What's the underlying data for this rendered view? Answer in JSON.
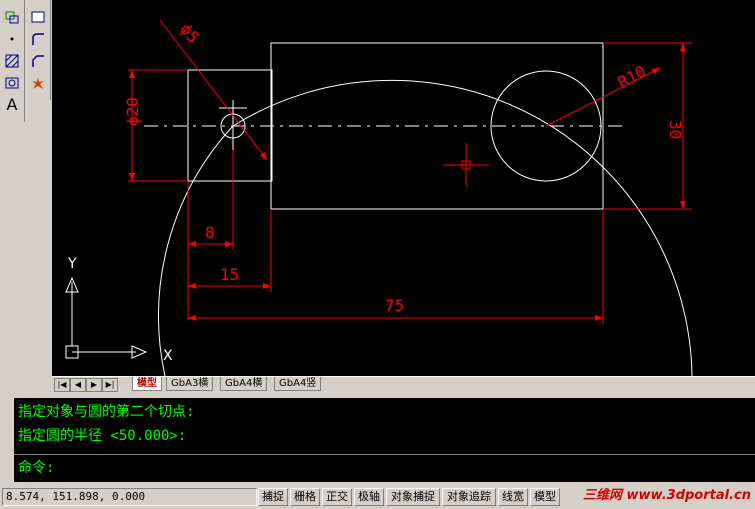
{
  "toolbar": {
    "left_icons": [
      "region-icon",
      "point-icon",
      "hatch-icon",
      "region-fill-icon",
      "text-icon"
    ],
    "text_tool_label": "A",
    "right_icons": [
      "rectangle-icon",
      "fillet-icon",
      "chamfer-icon",
      "explode-icon"
    ]
  },
  "drawing": {
    "dim_diameter5": "ϕ5",
    "dim_diameter20": "ϕ20",
    "dim_r10": "R10",
    "dim_30": "30",
    "dim_8": "8",
    "dim_15": "15",
    "dim_75": "75",
    "ucs_y": "Y",
    "ucs_x": "X",
    "colors": {
      "entity": "#ffffff",
      "dimension": "#ff0000",
      "background": "#000000"
    }
  },
  "tabs": {
    "nav": [
      "|◀",
      "◀",
      "▶",
      "▶|"
    ],
    "items": [
      {
        "label": "模型",
        "active": true
      },
      {
        "label": "GbA3横",
        "active": false
      },
      {
        "label": "GbA4横",
        "active": false
      },
      {
        "label": "GbA4竖",
        "active": false
      }
    ]
  },
  "command": {
    "history1": "指定对象与圆的第二个切点:",
    "history2": "指定圆的半径 <50.000>:",
    "prompt": "命令:"
  },
  "status": {
    "coords": "8.574,  151.898, 0.000",
    "buttons": [
      "捕捉",
      "栅格",
      "正交",
      "极轴",
      "对象捕捉",
      "对象追踪",
      "线宽",
      "模型"
    ],
    "watermark": "三维网 www.3dportal.cn"
  }
}
